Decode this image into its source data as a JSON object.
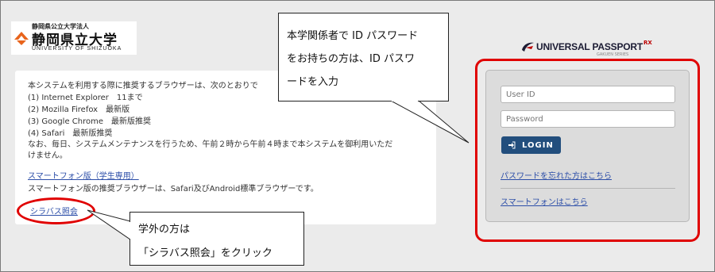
{
  "logo": {
    "corp": "静岡県公立大学法人",
    "name": "静岡県立大学",
    "english": "UNIVERSITY OF SHIZUOKA"
  },
  "notice": {
    "intro": "本システムを利用する際に推奨するブラウザーは、次のとおりで",
    "browsers": [
      "(1) Internet Explorer　11まで",
      "(2) Mozilla Firefox　最新版",
      "(3) Google Chrome　最新版推奨",
      "(4) Safari　最新版推奨"
    ],
    "maintenance_1": "なお、毎日、システムメンテナンスを行うため、午前２時から午前４時まで本システムを御利用いただ",
    "maintenance_2": "けません。",
    "smartphone_link": "スマートフォン版（学生専用）",
    "smartphone_note": "スマートフォン版の推奨ブラウザーは、Safari及びAndroid標準ブラウザーです。",
    "syllabus_link": "シラバス照会"
  },
  "callout_top": {
    "line1": "本学関係者で ID パスワード",
    "line2": "をお持ちの方は、ID パスワ",
    "line3": "ードを入力"
  },
  "callout_bottom": {
    "line1": "学外の方は",
    "line2": "「シラバス照会」をクリック"
  },
  "brand": {
    "title": "UNIVERSAL PASSPORT",
    "suffix": "RX",
    "subtitle": "GAKUEN SERIES"
  },
  "login": {
    "userid_placeholder": "User ID",
    "password_placeholder": "Password",
    "button_label": "LOGIN",
    "forgot_link": "パスワードを忘れた方はこちら",
    "smartphone_link": "スマートフォンはこちら"
  },
  "colors": {
    "highlight": "#e00000",
    "login_button": "#224e7d",
    "link": "#2c4ea8"
  },
  "icons": [
    "university-logo-icon",
    "universal-passport-logo-icon",
    "login-arrow-icon"
  ]
}
